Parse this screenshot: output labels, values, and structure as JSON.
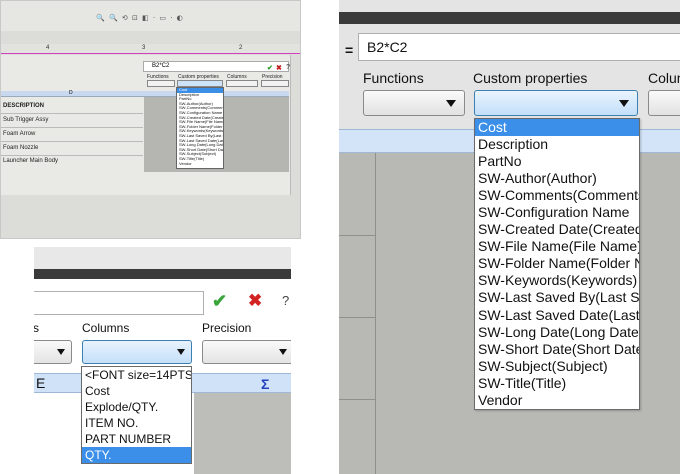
{
  "overview": {
    "ruler": [
      "4",
      "3",
      "2"
    ],
    "formula_text": "B2*C2",
    "headers": {
      "functions": "Functions",
      "custom": "Custom properties",
      "columns": "Columns",
      "precision": "Precision"
    },
    "col_letter": "D",
    "rows": [
      "DESCRIPTION",
      "Sub Trigger Assy",
      "Foam Arrow",
      "Foam Nozzle",
      "Launcher Main Body"
    ],
    "ok": "✔",
    "cancel": "✖",
    "help": "?"
  },
  "columns_view": {
    "labels": {
      "functions_partial": "s",
      "columns": "Columns",
      "precision": "Precision"
    },
    "ok": "✔",
    "cancel": "✖",
    "help": "?",
    "col_letter": "E",
    "sigma": "Σ",
    "items": [
      "<FONT size=14PTS",
      "Cost",
      "Explode/QTY.",
      "ITEM NO.",
      "PART NUMBER",
      "QTY."
    ],
    "selected_index": 5
  },
  "custom_view": {
    "equals": "=",
    "formula_text": "B2*C2",
    "labels": {
      "functions": "Functions",
      "custom": "Custom properties",
      "columns_partial": "Colum"
    },
    "items": [
      "Cost",
      "Description",
      "PartNo",
      "SW-Author(Author)",
      "SW-Comments(Comments)",
      "SW-Configuration Name",
      "SW-Created Date(Created Date)",
      "SW-File Name(File Name)",
      "SW-Folder Name(Folder Name)",
      "SW-Keywords(Keywords)",
      "SW-Last Saved By(Last Saved By)",
      "SW-Last Saved Date(Last Saved Date)",
      "SW-Long Date(Long Date)",
      "SW-Short Date(Short Date)",
      "SW-Subject(Subject)",
      "SW-Title(Title)",
      "Vendor"
    ],
    "selected_index": 0
  },
  "colors": {
    "selection": "#3b8fe8",
    "header_blue": "#d3e4f8",
    "ok_green": "#3aa53a",
    "cancel_red": "#d22222"
  }
}
